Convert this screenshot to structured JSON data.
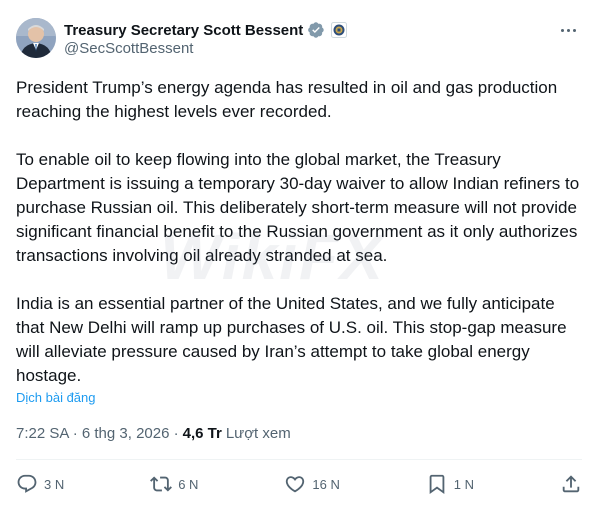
{
  "author": {
    "display_name": "Treasury Secretary Scott Bessent",
    "handle": "@SecScottBessent"
  },
  "tweet": {
    "paragraphs": [
      "President Trump’s energy agenda has resulted in oil and gas production reaching the highest levels ever recorded.",
      "To enable oil to keep flowing into the global market, the Treasury Department is issuing a temporary 30-day waiver to allow Indian refiners to purchase Russian oil. This deliberately short-term measure will not provide significant financial benefit to the Russian government as it only authorizes transactions involving oil already stranded at sea.",
      "India is an essential partner of the United States, and we fully anticipate that New Delhi will ramp up purchases of U.S. oil. This stop-gap measure will alleviate pressure caused by Iran’s attempt to take global energy hostage."
    ],
    "translate_label": "Dịch bài đăng",
    "timestamp": "7:22 SA · 6 thg 3, 2026 ·",
    "views_count": "4,6 Tr",
    "views_label": "Lượt xem"
  },
  "watermark": "WikiFX",
  "actions": {
    "reply_count": "3 N",
    "repost_count": "6 N",
    "like_count": "16 N",
    "bookmark_count": "1 N"
  },
  "colors": {
    "accent": "#1d9bf0",
    "secondary_text": "#536471",
    "primary_text": "#0f1419",
    "divider": "#eff3f4"
  },
  "icons": {
    "reply": "reply-icon",
    "repost": "repost-icon",
    "like": "heart-icon",
    "bookmark": "bookmark-icon",
    "share": "share-icon",
    "verified": "verified-badge-icon",
    "org": "treasury-seal-icon",
    "more": "more-options-icon"
  }
}
